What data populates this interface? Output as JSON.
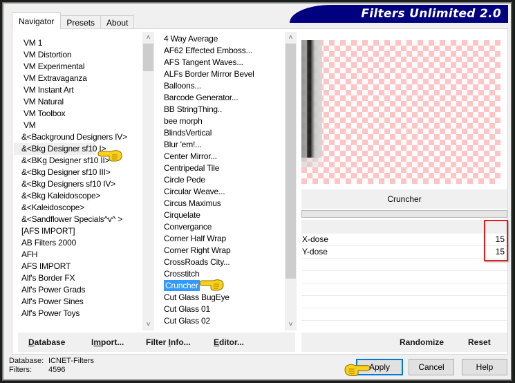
{
  "window": {
    "title": "Filters Unlimited 2.0"
  },
  "tabs": [
    {
      "label": "Navigator",
      "active": true
    },
    {
      "label": "Presets",
      "active": false
    },
    {
      "label": "About",
      "active": false
    }
  ],
  "categories": {
    "items": [
      "VM 1",
      "VM Distortion",
      "VM Experimental",
      "VM Extravaganza",
      "VM Instant Art",
      "VM Natural",
      "VM Toolbox",
      "VM",
      "&<Background Designers IV>",
      "&<Bkg Designer sf10 I>",
      "&<BKg Designer sf10 II>",
      "&<Bkg Designer sf10 III>",
      "&<Bkg Designers sf10 IV>",
      "&<Bkg Kaleidoscope>",
      "&<Kaleidoscope>",
      "&<Sandflower Specials^v^ >",
      "[AFS IMPORT]",
      "AB Filters 2000",
      "AFH",
      "AFS IMPORT",
      "Alf's Border FX",
      "Alf's Power Grads",
      "Alf's Power Sines",
      "Alf's Power Toys"
    ],
    "selected": "&<Bkg Designer sf10 I>"
  },
  "filters": {
    "items": [
      "4 Way Average",
      "AF62 Effected Emboss...",
      "AFS Tangent Waves...",
      "ALFs Border Mirror Bevel",
      "Balloons...",
      "Barcode Generator...",
      "BB StringThing..",
      "bee morph",
      "BlindsVertical",
      "Blur 'em!...",
      "Center Mirror...",
      "Centripedal Tile",
      "Circle Pede",
      "Circular Weave...",
      "Circus Maximus",
      "Cirquelate",
      "Convergance",
      "Corner Half Wrap",
      "Corner Right Wrap",
      "CrossRoads City...",
      "Crosstitch",
      "Cruncher",
      "Cut Glass  BugEye",
      "Cut Glass 01",
      "Cut Glass 02"
    ],
    "selected": "Cruncher"
  },
  "preview": {
    "filter_name": "Cruncher",
    "progress": 0
  },
  "params": [
    {
      "label": "X-dose",
      "value": "15"
    },
    {
      "label": "Y-dose",
      "value": "15"
    }
  ],
  "left_buttons": {
    "database": "Database",
    "import": "Import...",
    "filter_info": "Filter Info...",
    "editor": "Editor..."
  },
  "right_buttons": {
    "randomize": "Randomize",
    "reset": "Reset"
  },
  "status": {
    "database_label": "Database:",
    "database_value": "ICNET-Filters",
    "filters_label": "Filters:",
    "filters_value": "4596"
  },
  "dialog_buttons": {
    "apply": "Apply",
    "cancel": "Cancel",
    "help": "Help"
  },
  "colors": {
    "title_bg": "#000080",
    "selection": "#3399ff",
    "highlight_box": "#e21b1b",
    "default_button_border": "#0078d7"
  }
}
